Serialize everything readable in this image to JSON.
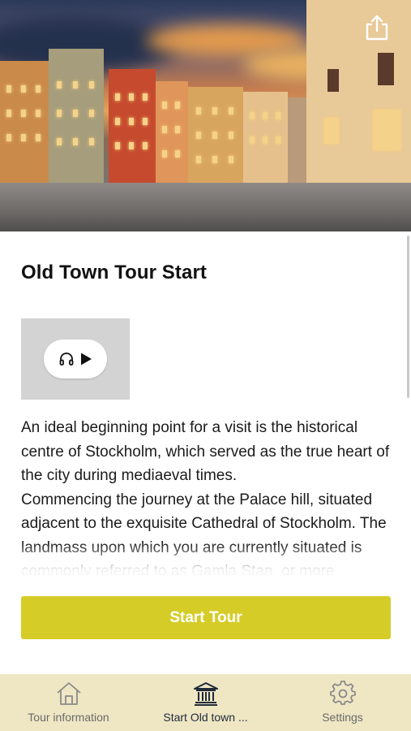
{
  "hero": {
    "share_icon": "share-upload-icon"
  },
  "title": "Old Town Tour Start",
  "audio": {
    "icons": [
      "headphones-icon",
      "play-icon"
    ]
  },
  "description": {
    "p1": "An ideal beginning point for a visit is the historical centre of Stockholm, which served as the true heart of the city during mediaeval times.",
    "p2": "Commencing the journey at the Palace hill, situated adjacent to the exquisite Cathedral of Stockholm. The landmass upon which you are currently situated is commonly referred to as Gamla Stan, or more"
  },
  "start_button_label": "Start Tour",
  "colors": {
    "accent": "#d6cc28",
    "nav_background": "#efe6c4"
  },
  "bottom_nav": {
    "items": [
      {
        "label": "Tour information",
        "icon": "home-icon"
      },
      {
        "label": "Start Old town ...",
        "icon": "landmark-icon",
        "active": true
      },
      {
        "label": "Settings",
        "icon": "gear-icon"
      }
    ]
  }
}
